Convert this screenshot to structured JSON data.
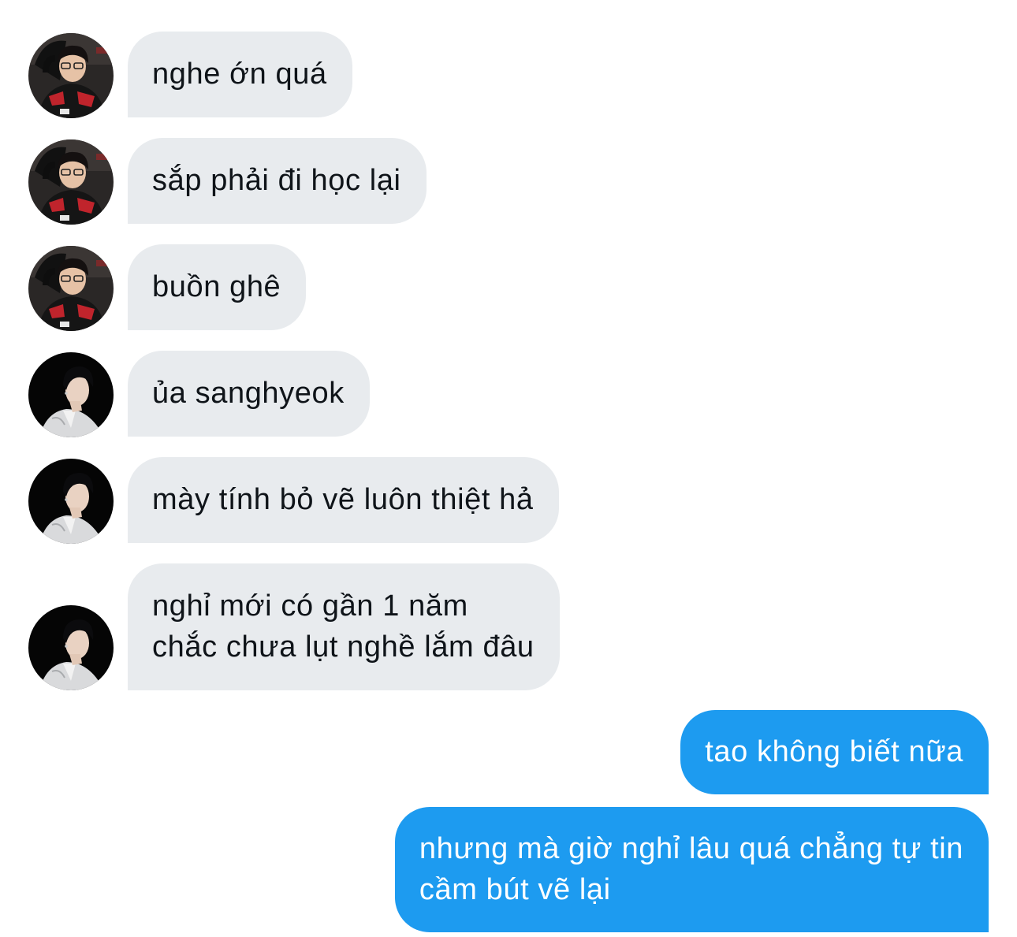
{
  "conversation": {
    "messages": [
      {
        "sender": "other",
        "avatar": "avatar-a",
        "text": "nghe ớn quá"
      },
      {
        "sender": "other",
        "avatar": "avatar-a",
        "text": "sắp phải đi học lại"
      },
      {
        "sender": "other",
        "avatar": "avatar-a",
        "text": "buồn ghê"
      },
      {
        "sender": "other",
        "avatar": "avatar-b",
        "text": "ủa sanghyeok"
      },
      {
        "sender": "other",
        "avatar": "avatar-b",
        "text": "mày tính bỏ vẽ luôn thiệt hả"
      },
      {
        "sender": "other",
        "avatar": "avatar-b",
        "text": "nghỉ mới có gần 1 năm\nchắc chưa lụt nghề lắm đâu"
      },
      {
        "sender": "me",
        "text": "tao không biết nữa"
      },
      {
        "sender": "me",
        "text": "nhưng mà giờ nghỉ lâu quá chẳng tự tin\ncầm bút vẽ lại"
      }
    ]
  },
  "colors": {
    "incoming_bubble": "#e8ebee",
    "incoming_text": "#0f1419",
    "outgoing_bubble": "#1d9bf0",
    "outgoing_text": "#ffffff",
    "background": "#ffffff"
  }
}
